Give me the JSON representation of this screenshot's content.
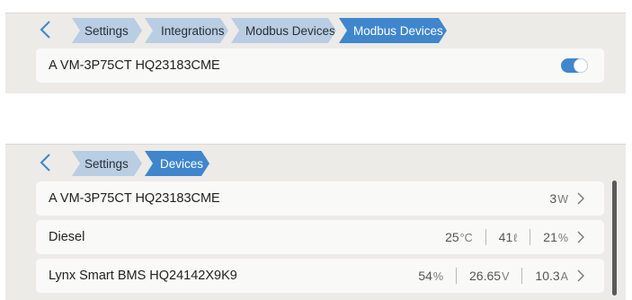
{
  "top": {
    "breadcrumbs": [
      {
        "label": "Settings"
      },
      {
        "label": "Integrations"
      },
      {
        "label": "Modbus Devices"
      },
      {
        "label": "Modbus Devices"
      }
    ],
    "item": {
      "label": "A VM-3P75CT HQ23183CME",
      "enabled": true
    }
  },
  "bottom": {
    "breadcrumbs": [
      {
        "label": "Settings"
      },
      {
        "label": "Devices"
      }
    ],
    "rows": [
      {
        "name": "A VM-3P75CT HQ23183CME",
        "values": [
          {
            "value": "3",
            "unit": "W"
          }
        ]
      },
      {
        "name": "Diesel",
        "values": [
          {
            "value": "25",
            "unit": "°C"
          },
          {
            "value": "41",
            "unit": "ℓ"
          },
          {
            "value": "21",
            "unit": "%"
          }
        ]
      },
      {
        "name": "Lynx Smart BMS HQ24142X9K9",
        "values": [
          {
            "value": "54",
            "unit": "%"
          },
          {
            "value": "26.65",
            "unit": "V"
          },
          {
            "value": "10.3",
            "unit": "A"
          }
        ]
      }
    ]
  },
  "colors": {
    "accent": "#3f86cc",
    "crumb": "#b9cde3",
    "panel": "#ecebe8",
    "row": "#f9f9f8"
  },
  "icons": {
    "back": "chevron-left-icon",
    "row": "chevron-right-icon"
  }
}
